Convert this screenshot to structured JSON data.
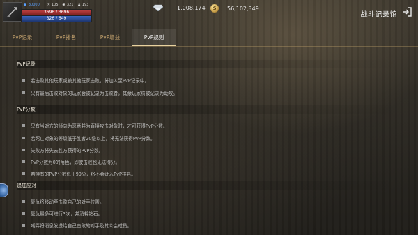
{
  "player": {
    "level": "30000",
    "stat1": "105",
    "stat2": "321",
    "stat3": "193",
    "hp_text": "3696 / 3696",
    "mp_text": "326 / 649",
    "hp_fraction": 1.0,
    "mp_fraction": 0.5
  },
  "currency": {
    "gems": "1,008,174",
    "gold": "56,102,349"
  },
  "header": {
    "title": "战斗记录馆"
  },
  "tabs": [
    {
      "label": "PvP记录",
      "active": false
    },
    {
      "label": "PvP排名",
      "active": false
    },
    {
      "label": "PvP增益",
      "active": false
    },
    {
      "label": "PvP规则",
      "active": true
    }
  ],
  "sections": [
    {
      "title": "PvP记录",
      "items": [
        "若击败其他玩家或被其他玩家击败，将加入至PvP记录中。",
        "只有最后击败对象的玩家会被记录为击败者，其余玩家将被记录为助攻。"
      ]
    },
    {
      "title": "PvP分数",
      "items": [
        "只有当对方的倾向为恶意并为直接攻击对象时，才可获得PvP分数。",
        "若死亡对象的等级低于胜者20级以上，将无法获得PvP分数。",
        "失败方将失去胜方获得的PvP分数。",
        "PvP分数为0的角色，即使击败也无法得分。",
        "若持有的PvP分数低于99分，将不会计入PvP排名。"
      ]
    },
    {
      "title": "追加应对",
      "items": [
        "复仇将移动至击败自己的对手位置。",
        "复仇最多可进行3次，并消耗钻石。",
        "嘲弄将消息发送给自己击败的对手及其公会成员。"
      ]
    }
  ],
  "colors": {
    "tab_text": "#c9a670",
    "active_tab_underline": "#e8d2a0",
    "hp": "#c34444",
    "mp": "#3a66c0"
  }
}
